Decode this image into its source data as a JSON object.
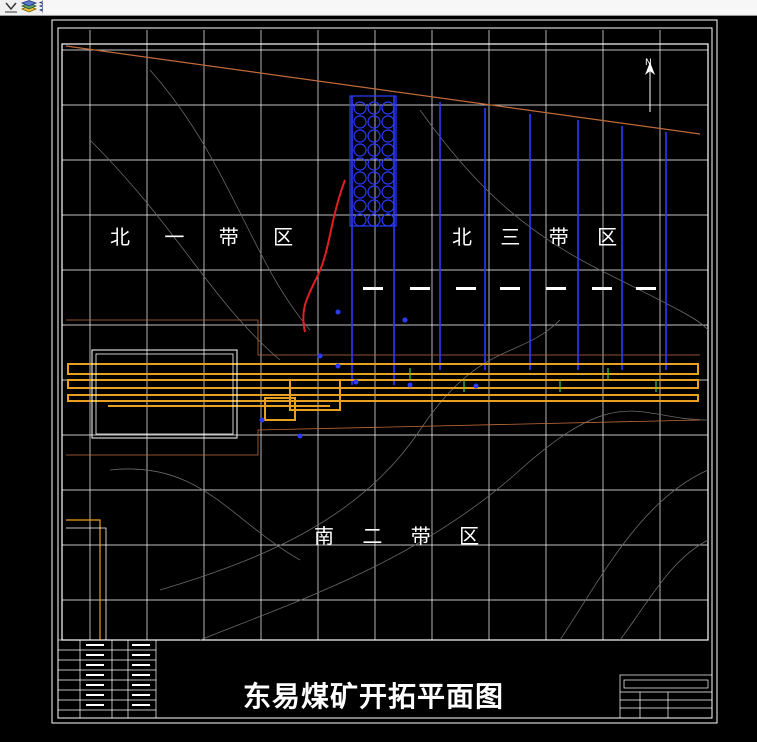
{
  "toolbar": {
    "buttons": [
      {
        "name": "down-arrow-icon"
      },
      {
        "name": "layers-icon"
      },
      {
        "name": "layers-stack-icon"
      }
    ]
  },
  "drawing": {
    "title": "东易煤矿开拓平面图",
    "zones": {
      "north1": "北 一 带 区",
      "north3": "北 三 带 区",
      "south2": "南 二 带 区"
    },
    "north_arrow_label": "N",
    "colors": {
      "background": "#000000",
      "grid": "#ffffff",
      "roadway_orange": "#e8a020",
      "roadway_blue": "#2b3bff",
      "fault_red": "#e02020",
      "contour": "#6a6a6a",
      "boundary_brown": "#c06a3a"
    }
  }
}
